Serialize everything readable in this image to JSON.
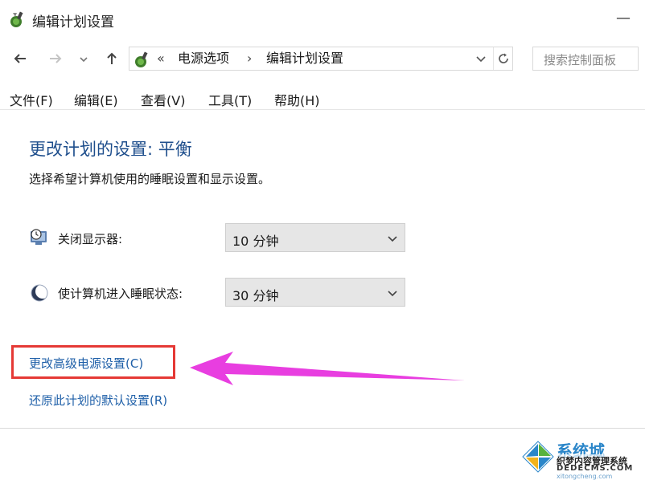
{
  "window": {
    "title": "编辑计划设置",
    "minimize_label": "—"
  },
  "nav": {
    "back_icon": "arrow-left-icon",
    "forward_icon": "arrow-right-icon",
    "recent_icon": "chevron-down-icon",
    "up_icon": "arrow-up-icon",
    "address": {
      "separator_root": "«",
      "crumbs": [
        "电源选项",
        "编辑计划设置"
      ],
      "crumb_separator": "›"
    },
    "search_placeholder": "搜索控制面板"
  },
  "menu": [
    "文件(F)",
    "编辑(E)",
    "查看(V)",
    "工具(T)",
    "帮助(H)"
  ],
  "content": {
    "title": "更改计划的设置: 平衡",
    "subtitle": "选择希望计算机使用的睡眠设置和显示设置。",
    "settings": [
      {
        "label": "关闭显示器:",
        "value": "10 分钟",
        "icon": "monitor-clock-icon"
      },
      {
        "label": "使计算机进入睡眠状态:",
        "value": "30 分钟",
        "icon": "moon-icon"
      }
    ],
    "links": {
      "advanced": "更改高级电源设置(C)",
      "restore": "还原此计划的默认设置(R)"
    }
  },
  "annotation": {
    "box_color": "#e53935",
    "arrow_color": "#e83ee0"
  },
  "watermark": {
    "line1": "系统城",
    "line2": "织梦内容管理系统",
    "line3": "DEDECMS.COM",
    "line4": "xitongcheng.com"
  },
  "colors": {
    "accent_title": "#1e4e8c",
    "link": "#1e5fa8"
  }
}
